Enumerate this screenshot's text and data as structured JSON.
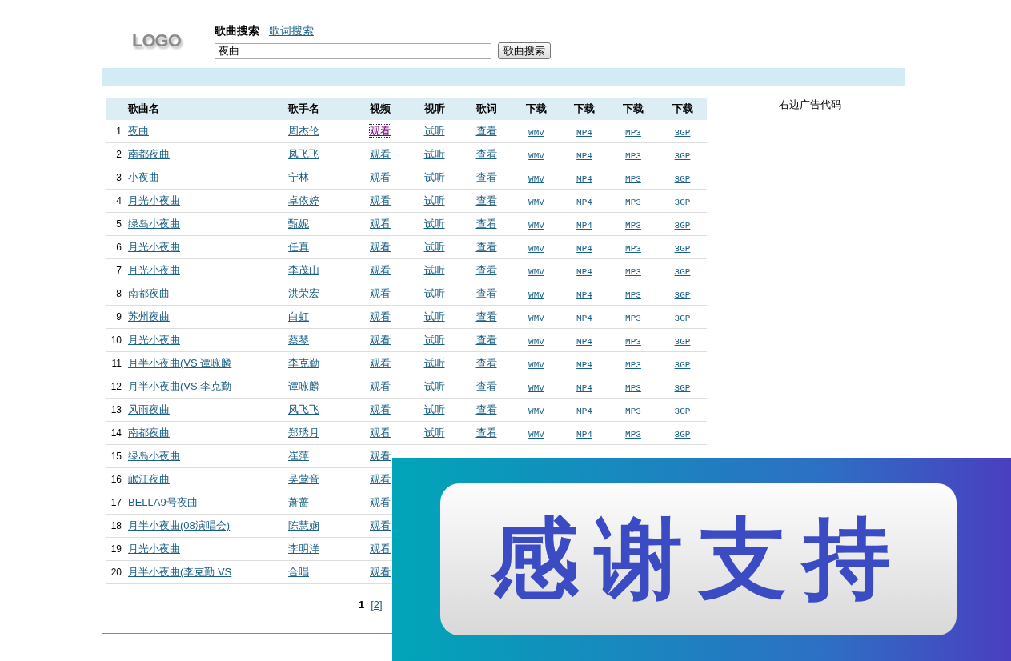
{
  "logo": "LOGO",
  "search": {
    "tabs": [
      {
        "label": "歌曲搜索",
        "selected": true
      },
      {
        "label": "歌词搜索",
        "selected": false
      }
    ],
    "value": "夜曲",
    "button": "歌曲搜索"
  },
  "table": {
    "columns": [
      "歌曲名",
      "歌手名",
      "视频",
      "视听",
      "歌词",
      "下载",
      "下载",
      "下载",
      "下载"
    ],
    "rows": [
      {
        "num": "1",
        "song": "夜曲",
        "singer": "周杰伦",
        "links": [
          {
            "text": "观看",
            "focused": true
          },
          {
            "text": "试听",
            "focused": false
          },
          {
            "text": "查看",
            "focused": false
          },
          {
            "text": "WMV",
            "focused": false
          },
          {
            "text": "MP4",
            "focused": false
          },
          {
            "text": "MP3",
            "focused": false
          },
          {
            "text": "3GP",
            "focused": false
          }
        ]
      },
      {
        "num": "2",
        "song": "南都夜曲",
        "singer": "凤飞飞",
        "links": [
          {
            "text": "观看",
            "focused": false
          },
          {
            "text": "试听",
            "focused": false
          },
          {
            "text": "查看",
            "focused": false
          },
          {
            "text": "WMV",
            "focused": false
          },
          {
            "text": "MP4",
            "focused": false
          },
          {
            "text": "MP3",
            "focused": false
          },
          {
            "text": "3GP",
            "focused": false
          }
        ]
      },
      {
        "num": "3",
        "song": "小夜曲",
        "singer": "宁林",
        "links": [
          {
            "text": "观看",
            "focused": false
          },
          {
            "text": "试听",
            "focused": false
          },
          {
            "text": "查看",
            "focused": false
          },
          {
            "text": "WMV",
            "focused": false
          },
          {
            "text": "MP4",
            "focused": false
          },
          {
            "text": "MP3",
            "focused": false
          },
          {
            "text": "3GP",
            "focused": false
          }
        ]
      },
      {
        "num": "4",
        "song": "月光小夜曲",
        "singer": "卓依婷",
        "links": [
          {
            "text": "观看",
            "focused": false
          },
          {
            "text": "试听",
            "focused": false
          },
          {
            "text": "查看",
            "focused": false
          },
          {
            "text": "WMV",
            "focused": false
          },
          {
            "text": "MP4",
            "focused": false
          },
          {
            "text": "MP3",
            "focused": false
          },
          {
            "text": "3GP",
            "focused": false
          }
        ]
      },
      {
        "num": "5",
        "song": "绿岛小夜曲",
        "singer": "甄妮",
        "links": [
          {
            "text": "观看",
            "focused": false
          },
          {
            "text": "试听",
            "focused": false
          },
          {
            "text": "查看",
            "focused": false
          },
          {
            "text": "WMV",
            "focused": false
          },
          {
            "text": "MP4",
            "focused": false
          },
          {
            "text": "MP3",
            "focused": false
          },
          {
            "text": "3GP",
            "focused": false
          }
        ]
      },
      {
        "num": "6",
        "song": "月光小夜曲",
        "singer": "任真",
        "links": [
          {
            "text": "观看",
            "focused": false
          },
          {
            "text": "试听",
            "focused": false
          },
          {
            "text": "查看",
            "focused": false
          },
          {
            "text": "WMV",
            "focused": false
          },
          {
            "text": "MP4",
            "focused": false
          },
          {
            "text": "MP3",
            "focused": false
          },
          {
            "text": "3GP",
            "focused": false
          }
        ]
      },
      {
        "num": "7",
        "song": "月光小夜曲",
        "singer": "李茂山",
        "links": [
          {
            "text": "观看",
            "focused": false
          },
          {
            "text": "试听",
            "focused": false
          },
          {
            "text": "查看",
            "focused": false
          },
          {
            "text": "WMV",
            "focused": false
          },
          {
            "text": "MP4",
            "focused": false
          },
          {
            "text": "MP3",
            "focused": false
          },
          {
            "text": "3GP",
            "focused": false
          }
        ]
      },
      {
        "num": "8",
        "song": "南都夜曲",
        "singer": "洪荣宏",
        "links": [
          {
            "text": "观看",
            "focused": false
          },
          {
            "text": "试听",
            "focused": false
          },
          {
            "text": "查看",
            "focused": false
          },
          {
            "text": "WMV",
            "focused": false
          },
          {
            "text": "MP4",
            "focused": false
          },
          {
            "text": "MP3",
            "focused": false
          },
          {
            "text": "3GP",
            "focused": false
          }
        ]
      },
      {
        "num": "9",
        "song": "苏州夜曲",
        "singer": "白虹",
        "links": [
          {
            "text": "观看",
            "focused": false
          },
          {
            "text": "试听",
            "focused": false
          },
          {
            "text": "查看",
            "focused": false
          },
          {
            "text": "WMV",
            "focused": false
          },
          {
            "text": "MP4",
            "focused": false
          },
          {
            "text": "MP3",
            "focused": false
          },
          {
            "text": "3GP",
            "focused": false
          }
        ]
      },
      {
        "num": "10",
        "song": "月光小夜曲",
        "singer": "蔡琴",
        "links": [
          {
            "text": "观看",
            "focused": false
          },
          {
            "text": "试听",
            "focused": false
          },
          {
            "text": "查看",
            "focused": false
          },
          {
            "text": "WMV",
            "focused": false
          },
          {
            "text": "MP4",
            "focused": false
          },
          {
            "text": "MP3",
            "focused": false
          },
          {
            "text": "3GP",
            "focused": false
          }
        ]
      },
      {
        "num": "11",
        "song": "月半小夜曲(VS 谭咏麟",
        "singer": "李克勤",
        "links": [
          {
            "text": "观看",
            "focused": false
          },
          {
            "text": "试听",
            "focused": false
          },
          {
            "text": "查看",
            "focused": false
          },
          {
            "text": "WMV",
            "focused": false
          },
          {
            "text": "MP4",
            "focused": false
          },
          {
            "text": "MP3",
            "focused": false
          },
          {
            "text": "3GP",
            "focused": false
          }
        ]
      },
      {
        "num": "12",
        "song": "月半小夜曲(VS 李克勤",
        "singer": "谭咏麟",
        "links": [
          {
            "text": "观看",
            "focused": false
          },
          {
            "text": "试听",
            "focused": false
          },
          {
            "text": "查看",
            "focused": false
          },
          {
            "text": "WMV",
            "focused": false
          },
          {
            "text": "MP4",
            "focused": false
          },
          {
            "text": "MP3",
            "focused": false
          },
          {
            "text": "3GP",
            "focused": false
          }
        ]
      },
      {
        "num": "13",
        "song": "风雨夜曲",
        "singer": "凤飞飞",
        "links": [
          {
            "text": "观看",
            "focused": false
          },
          {
            "text": "试听",
            "focused": false
          },
          {
            "text": "查看",
            "focused": false
          },
          {
            "text": "WMV",
            "focused": false
          },
          {
            "text": "MP4",
            "focused": false
          },
          {
            "text": "MP3",
            "focused": false
          },
          {
            "text": "3GP",
            "focused": false
          }
        ]
      },
      {
        "num": "14",
        "song": "南都夜曲",
        "singer": "郑琇月",
        "links": [
          {
            "text": "观看",
            "focused": false
          },
          {
            "text": "试听",
            "focused": false
          },
          {
            "text": "查看",
            "focused": false
          },
          {
            "text": "WMV",
            "focused": false
          },
          {
            "text": "MP4",
            "focused": false
          },
          {
            "text": "MP3",
            "focused": false
          },
          {
            "text": "3GP",
            "focused": false
          }
        ]
      },
      {
        "num": "15",
        "song": "绿岛小夜曲",
        "singer": "崔萍",
        "links": [
          {
            "text": "观看",
            "focused": false
          }
        ]
      },
      {
        "num": "16",
        "song": "岷江夜曲",
        "singer": "吴莺音",
        "links": [
          {
            "text": "观看",
            "focused": false
          }
        ]
      },
      {
        "num": "17",
        "song": "BELLA9号夜曲",
        "singer": "萧蔷",
        "links": [
          {
            "text": "观看",
            "focused": false
          }
        ]
      },
      {
        "num": "18",
        "song": "月半小夜曲(08演唱会)",
        "singer": "陈慧娴",
        "links": [
          {
            "text": "观看",
            "focused": false
          }
        ]
      },
      {
        "num": "19",
        "song": "月光小夜曲",
        "singer": "李明洋",
        "links": [
          {
            "text": "观看",
            "focused": false
          }
        ]
      },
      {
        "num": "20",
        "song": "月半小夜曲(李克勤 VS",
        "singer": "合唱",
        "links": [
          {
            "text": "观看",
            "focused": false
          }
        ]
      }
    ]
  },
  "pagination": [
    {
      "label": "1",
      "selected": true
    },
    {
      "label": "[2]",
      "selected": false
    }
  ],
  "ad": "右边广告代码",
  "banner": "感谢支持"
}
